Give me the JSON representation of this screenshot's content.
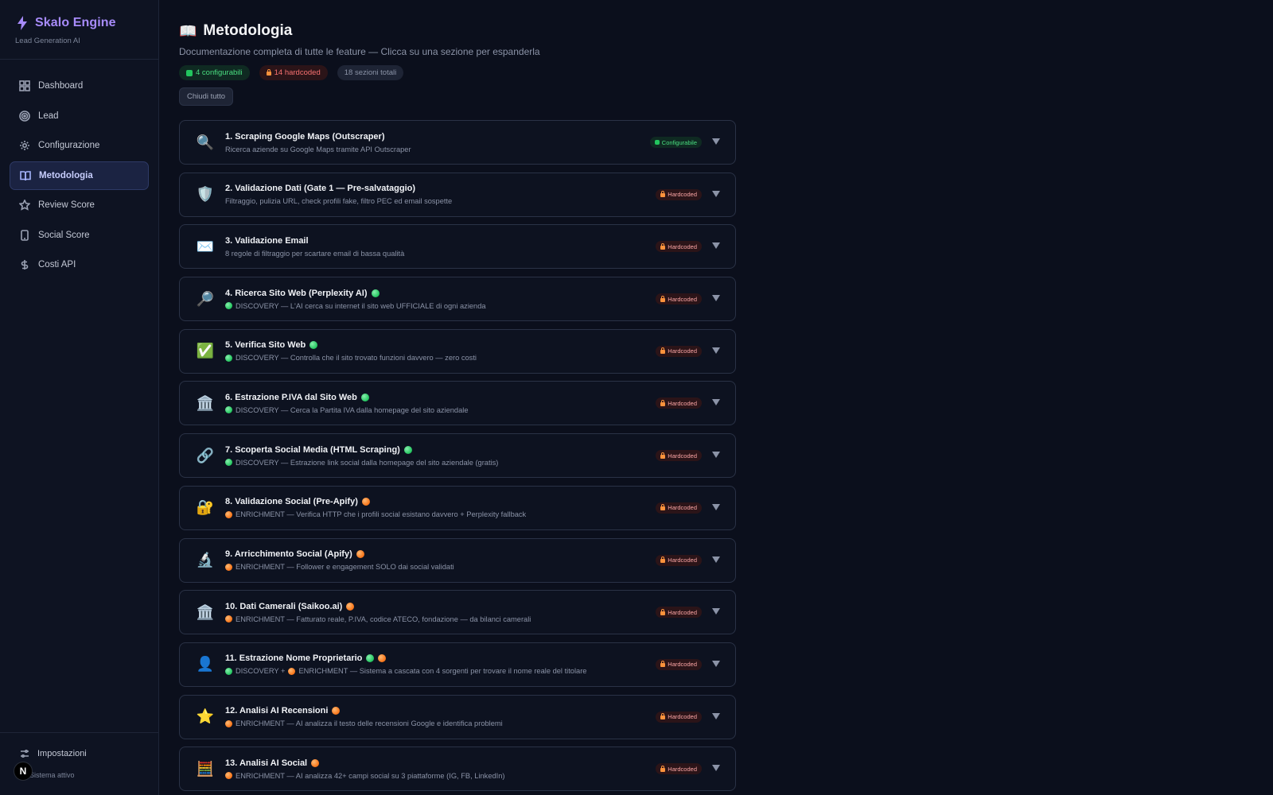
{
  "app": {
    "name": "Skalo Engine",
    "subtitle": "Lead Generation AI"
  },
  "sidebar": {
    "items": [
      {
        "label": "Dashboard",
        "icon": "dashboard-icon"
      },
      {
        "label": "Lead",
        "icon": "target-icon"
      },
      {
        "label": "Configurazione",
        "icon": "gear-icon"
      },
      {
        "label": "Metodologia",
        "icon": "book-icon",
        "active": true
      },
      {
        "label": "Review Score",
        "icon": "star-icon"
      },
      {
        "label": "Social Score",
        "icon": "phone-icon"
      },
      {
        "label": "Costi API",
        "icon": "dollar-icon"
      }
    ],
    "settings_label": "Impostazioni",
    "status_label": "Sistema attivo",
    "n_badge": "N"
  },
  "page": {
    "title_icon": "📖",
    "title": "Metodologia",
    "subtitle": "Documentazione completa di tutte le feature — Clicca su una sezione per espanderla",
    "pills": {
      "configurable": "4 configurabili",
      "hardcoded": "14 hardcoded",
      "total": "18 sezioni totali"
    },
    "close_all_label": "Chiudi tutto"
  },
  "badges": {
    "configurable": "Configurabile",
    "hardcoded": "Hardcoded"
  },
  "sections": [
    {
      "icon": "🔍",
      "title": "1. Scraping Google Maps (Outscraper)",
      "title_dots": [],
      "desc_prefix_dots": [],
      "desc": "Ricerca aziende su Google Maps tramite API Outscraper",
      "badge": "conf"
    },
    {
      "icon": "🛡️",
      "title": "2. Validazione Dati (Gate 1 — Pre-salvataggio)",
      "title_dots": [],
      "desc_prefix_dots": [],
      "desc": "Filtraggio, pulizia URL, check profili fake, filtro PEC ed email sospette",
      "badge": "hard"
    },
    {
      "icon": "✉️",
      "title": "3. Validazione Email",
      "title_dots": [],
      "desc_prefix_dots": [],
      "desc": "8 regole di filtraggio per scartare email di bassa qualità",
      "badge": "hard"
    },
    {
      "icon": "🔎",
      "title": "4. Ricerca Sito Web (Perplexity AI)",
      "title_dots": [
        "green"
      ],
      "desc_prefix_dots": [
        "green"
      ],
      "desc": "DISCOVERY — L'AI cerca su internet il sito web UFFICIALE di ogni azienda",
      "badge": "hard"
    },
    {
      "icon": "✅",
      "title": "5. Verifica Sito Web",
      "title_dots": [
        "green"
      ],
      "desc_prefix_dots": [
        "green"
      ],
      "desc": "DISCOVERY — Controlla che il sito trovato funzioni davvero — zero costi",
      "badge": "hard"
    },
    {
      "icon": "🏛️",
      "title": "6. Estrazione P.IVA dal Sito Web",
      "title_dots": [
        "green"
      ],
      "desc_prefix_dots": [
        "green"
      ],
      "desc": "DISCOVERY — Cerca la Partita IVA dalla homepage del sito aziendale",
      "badge": "hard"
    },
    {
      "icon": "🔗",
      "title": "7. Scoperta Social Media (HTML Scraping)",
      "title_dots": [
        "green"
      ],
      "desc_prefix_dots": [
        "green"
      ],
      "desc": "DISCOVERY — Estrazione link social dalla homepage del sito aziendale (gratis)",
      "badge": "hard"
    },
    {
      "icon": "🔐",
      "title": "8. Validazione Social (Pre-Apify)",
      "title_dots": [
        "orange"
      ],
      "desc_prefix_dots": [
        "orange"
      ],
      "desc": "ENRICHMENT — Verifica HTTP che i profili social esistano davvero + Perplexity fallback",
      "badge": "hard"
    },
    {
      "icon": "🔬",
      "title": "9. Arricchimento Social (Apify)",
      "title_dots": [
        "orange"
      ],
      "desc_prefix_dots": [
        "orange"
      ],
      "desc": "ENRICHMENT — Follower e engagement SOLO dai social validati",
      "badge": "hard"
    },
    {
      "icon": "🏛️",
      "title": "10. Dati Camerali (Saikoo.ai)",
      "title_dots": [
        "orange"
      ],
      "desc_prefix_dots": [
        "orange"
      ],
      "desc": "ENRICHMENT — Fatturato reale, P.IVA, codice ATECO, fondazione — da bilanci camerali",
      "badge": "hard"
    },
    {
      "icon": "👤",
      "title": "11. Estrazione Nome Proprietario",
      "title_dots": [
        "green",
        "orange"
      ],
      "desc_prefix_dots": [
        "green"
      ],
      "desc_mid": "DISCOVERY +",
      "desc_mid_dot": "orange",
      "desc": "ENRICHMENT — Sistema a cascata con 4 sorgenti per trovare il nome reale del titolare",
      "badge": "hard"
    },
    {
      "icon": "⭐",
      "title": "12. Analisi AI Recensioni",
      "title_dots": [
        "orange"
      ],
      "desc_prefix_dots": [
        "orange"
      ],
      "desc": "ENRICHMENT — AI analizza il testo delle recensioni Google e identifica problemi",
      "badge": "hard"
    },
    {
      "icon": "🧮",
      "title": "13. Analisi AI Social",
      "title_dots": [
        "orange"
      ],
      "desc_prefix_dots": [
        "orange"
      ],
      "desc": "ENRICHMENT — AI analizza 42+ campi social su 3 piattaforme (IG, FB, LinkedIn)",
      "badge": "hard"
    }
  ]
}
